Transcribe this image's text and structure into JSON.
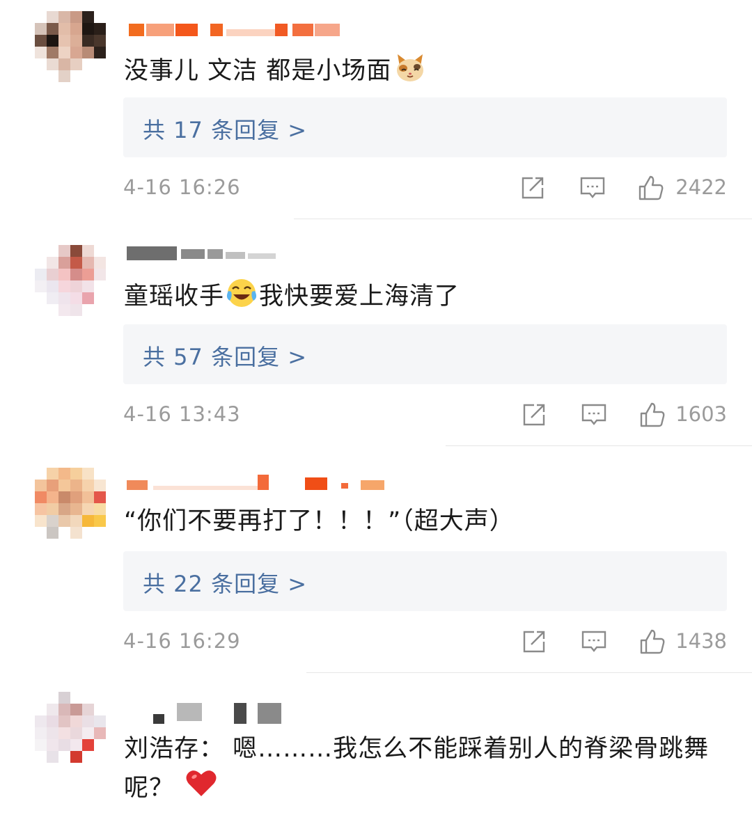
{
  "comments": [
    {
      "text": "没事儿 文洁 都是小场面",
      "emoji": "cat-face-emoji",
      "replies_label": "共 17 条回复 >",
      "time": "4-16 16:26",
      "likes": "2422"
    },
    {
      "text_before": "童瑶收手",
      "emoji": "laughing-crying-emoji",
      "text_after": "我快要爱上海清了",
      "replies_label": "共 57 条回复 >",
      "time": "4-16 13:43",
      "likes": "1603"
    },
    {
      "text": "“你们不要再打了！！！”（超大声）",
      "replies_label": "共 22 条回复 >",
      "time": "4-16 16:29",
      "likes": "1438"
    },
    {
      "text": "刘浩存： 嗯………我怎么不能踩着别人的脊梁骨跳舞呢？",
      "emoji": "red-heart-emoji"
    }
  ],
  "icons": {
    "share": "share-icon",
    "comment": "comment-icon",
    "like": "thumbs-up-icon"
  },
  "colors": {
    "reply_link": "#4a6fa0",
    "meta_gray": "#9b9b9b",
    "reply_bg": "#f5f6f8"
  }
}
